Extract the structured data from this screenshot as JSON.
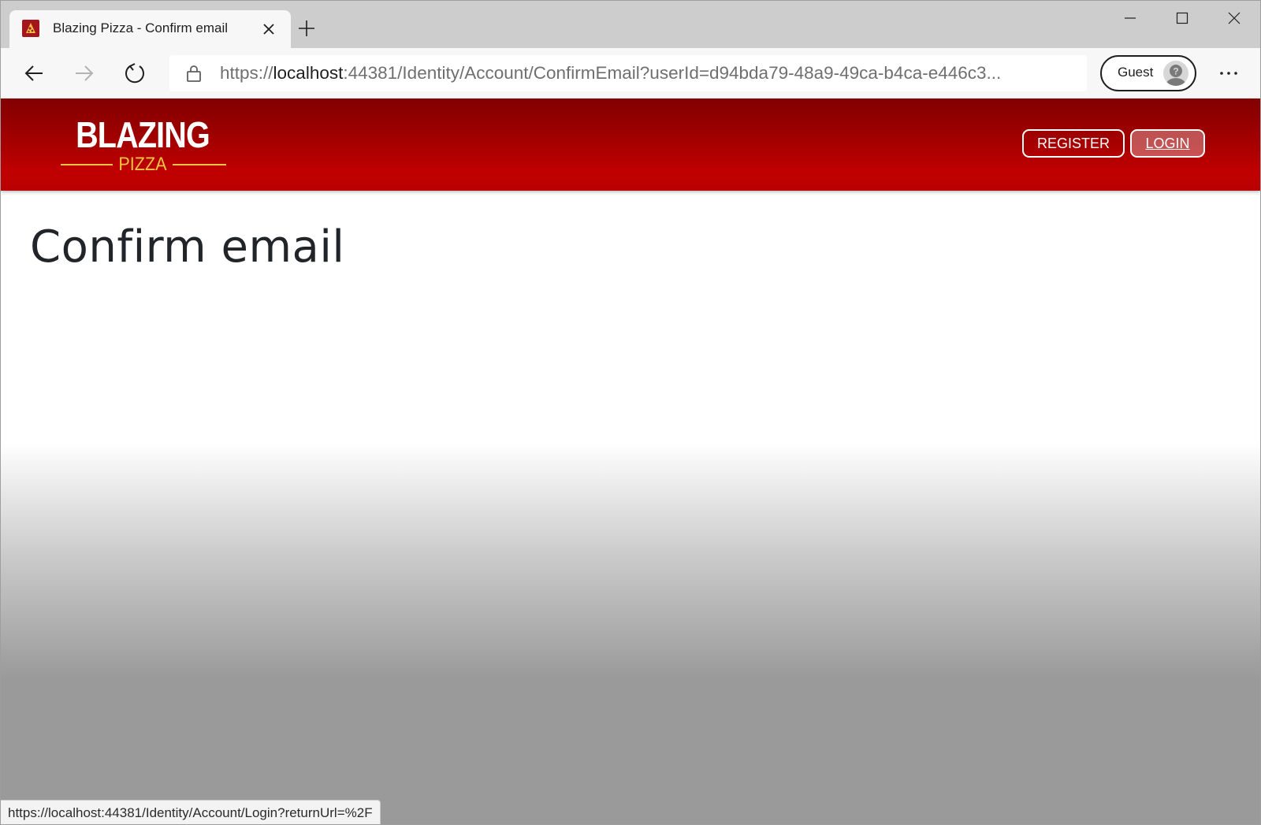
{
  "browser": {
    "tab": {
      "title": "Blazing Pizza - Confirm email",
      "favicon": "pizza-slice-icon"
    },
    "address": {
      "scheme": "https://",
      "host": "localhost",
      "rest": ":44381/Identity/Account/ConfirmEmail?userId=d94bda79-48a9-49ca-b4ca-e446c3..."
    },
    "profile_label": "Guest",
    "status_url": "https://localhost:44381/Identity/Account/Login?returnUrl=%2F"
  },
  "site": {
    "logo": {
      "line1": "BLAZING",
      "line2": "PIZZA"
    },
    "nav": {
      "register": "REGISTER",
      "login": "LOGIN"
    },
    "page_title": "Confirm email"
  },
  "colors": {
    "header_dark": "#820000",
    "header_light": "#c00000",
    "logo_accent": "#f5c443",
    "title_text": "#212529"
  }
}
